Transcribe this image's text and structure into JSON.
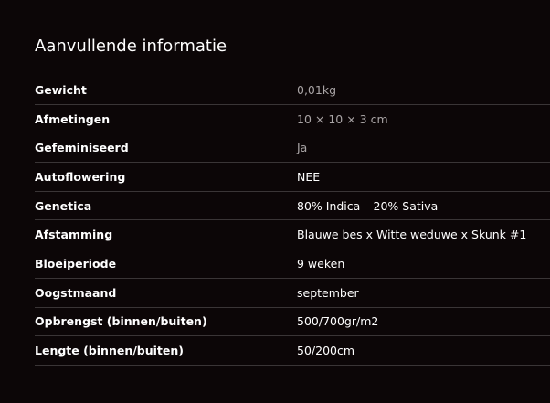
{
  "section": {
    "title": "Aanvullende informatie"
  },
  "colors": {
    "background": "#0c0607",
    "text": "#ffffff",
    "muted_text": "#a9a4a5",
    "divider": "#3a3536"
  },
  "rows": [
    {
      "label": "Gewicht",
      "value": "0,01kg"
    },
    {
      "label": "Afmetingen",
      "value": "10 × 10 × 3 cm"
    },
    {
      "label": "Gefeminiseerd",
      "value": "Ja"
    },
    {
      "label": "Autoflowering",
      "value": "NEE"
    },
    {
      "label": "Genetica",
      "value": "80% Indica – 20% Sativa"
    },
    {
      "label": "Afstamming",
      "value": "Blauwe bes x Witte weduwe x Skunk #1"
    },
    {
      "label": "Bloeiperiode",
      "value": "9 weken"
    },
    {
      "label": "Oogstmaand",
      "value": "september"
    },
    {
      "label": "Opbrengst (binnen/buiten)",
      "value": "500/700gr/m2"
    },
    {
      "label": "Lengte (binnen/buiten)",
      "value": "50/200cm"
    }
  ]
}
